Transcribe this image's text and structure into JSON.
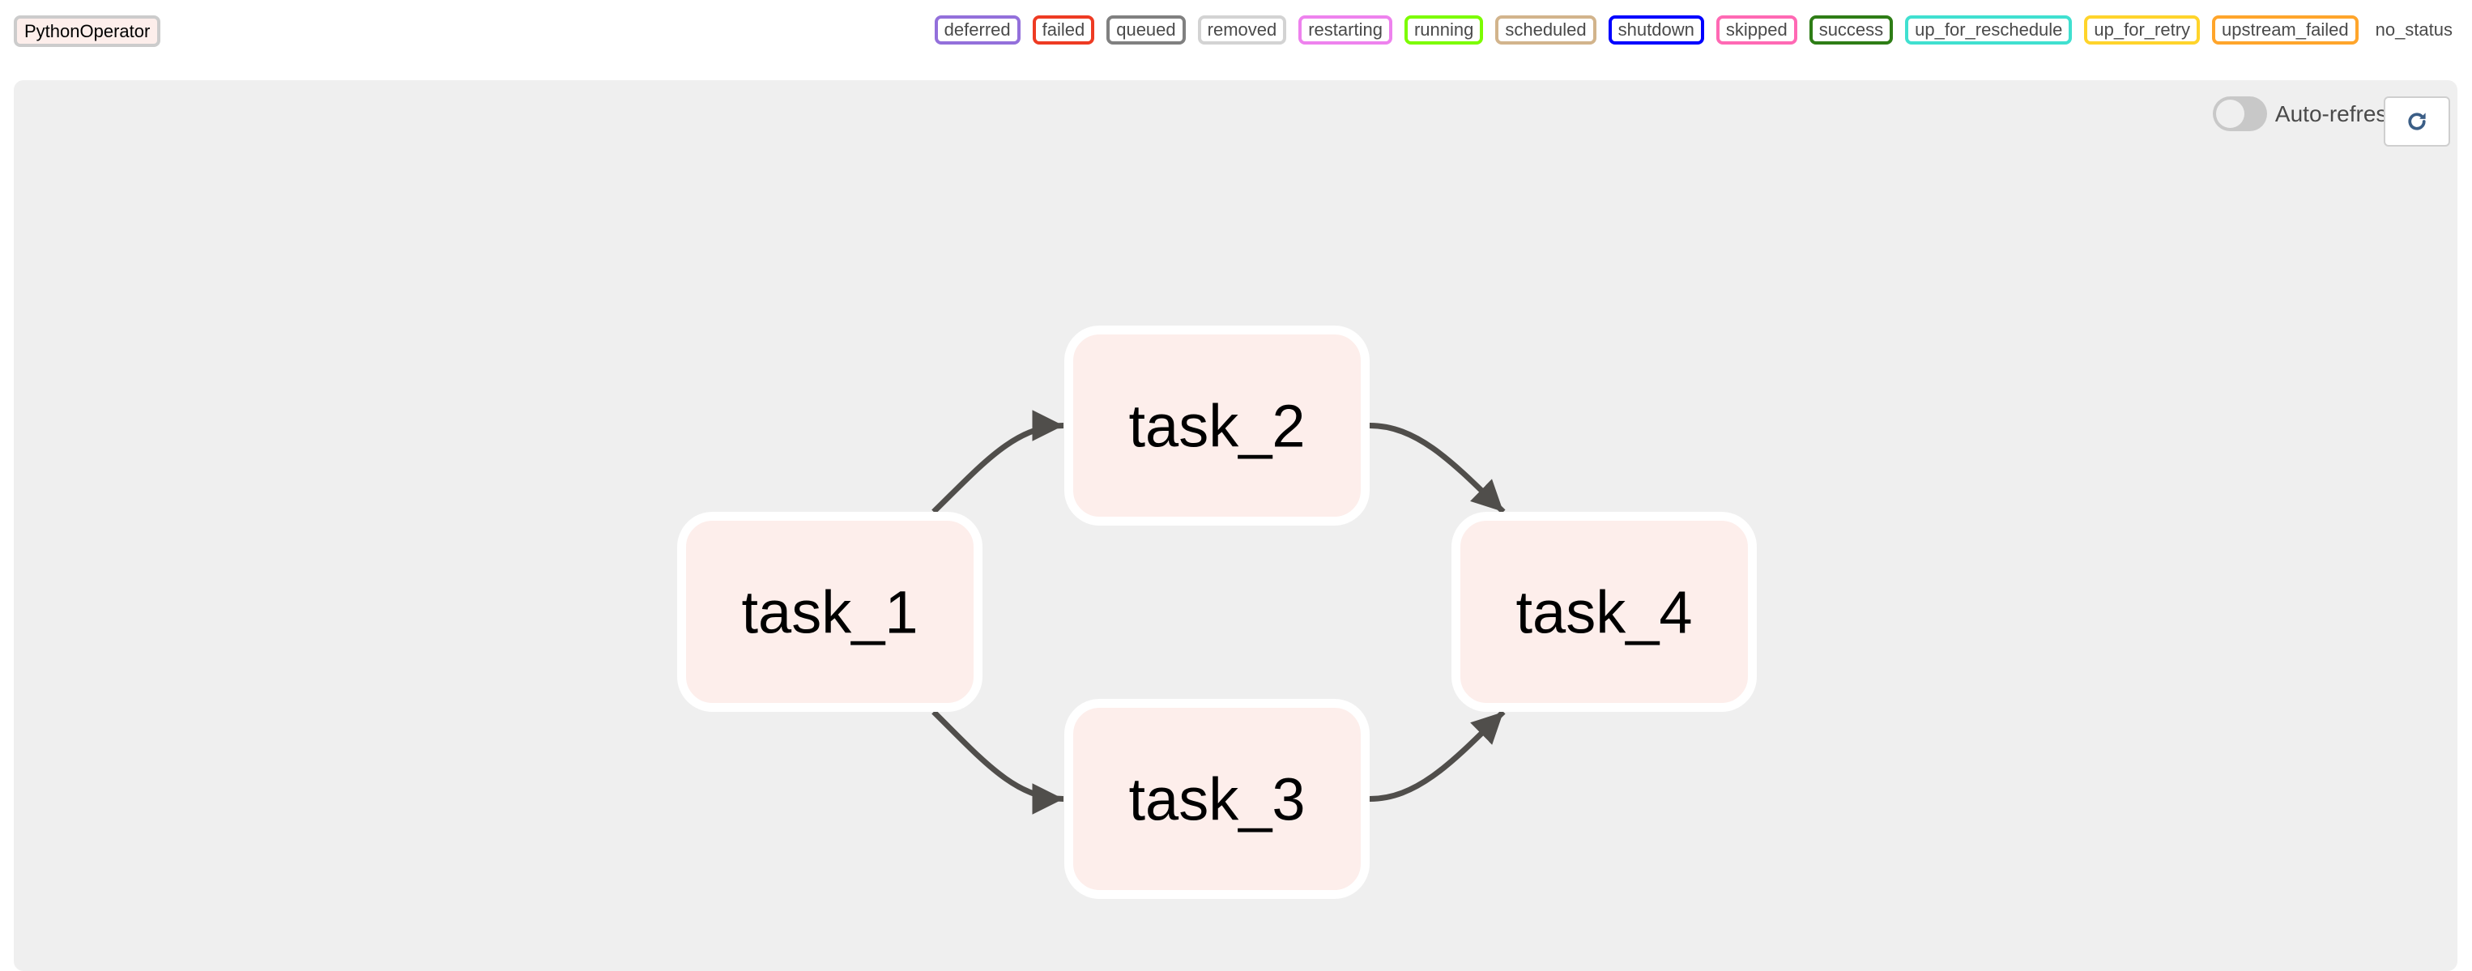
{
  "operator_chip": {
    "label": "PythonOperator",
    "fill": "#fdeeeb",
    "border": "#cccccc"
  },
  "legend": [
    {
      "label": "deferred",
      "color": "#9370db"
    },
    {
      "label": "failed",
      "color": "#ee3b23"
    },
    {
      "label": "queued",
      "color": "#808080"
    },
    {
      "label": "removed",
      "color": "#d3d3d3"
    },
    {
      "label": "restarting",
      "color": "#ee82ee"
    },
    {
      "label": "running",
      "color": "#7cfc00"
    },
    {
      "label": "scheduled",
      "color": "#d2b48c"
    },
    {
      "label": "shutdown",
      "color": "#0000ff"
    },
    {
      "label": "skipped",
      "color": "#ff69b4"
    },
    {
      "label": "success",
      "color": "#2e7d16"
    },
    {
      "label": "up_for_reschedule",
      "color": "#40e0d0"
    },
    {
      "label": "up_for_retry",
      "color": "#ffd42b"
    },
    {
      "label": "upstream_failed",
      "color": "#ffa52b"
    },
    {
      "label": "no_status",
      "color": null
    }
  ],
  "controls": {
    "auto_refresh_label": "Auto-refresh",
    "auto_refresh_on": false,
    "refresh_icon": "refresh-icon"
  },
  "graph": {
    "node_fill": "#fdeeeb",
    "node_border": "#ffffff",
    "edge_color": "#504e4b",
    "nodes": [
      {
        "id": "task_1",
        "label": "task_1"
      },
      {
        "id": "task_2",
        "label": "task_2"
      },
      {
        "id": "task_3",
        "label": "task_3"
      },
      {
        "id": "task_4",
        "label": "task_4"
      }
    ],
    "edges": [
      {
        "from": "task_1",
        "to": "task_2"
      },
      {
        "from": "task_1",
        "to": "task_3"
      },
      {
        "from": "task_2",
        "to": "task_4"
      },
      {
        "from": "task_3",
        "to": "task_4"
      }
    ]
  }
}
